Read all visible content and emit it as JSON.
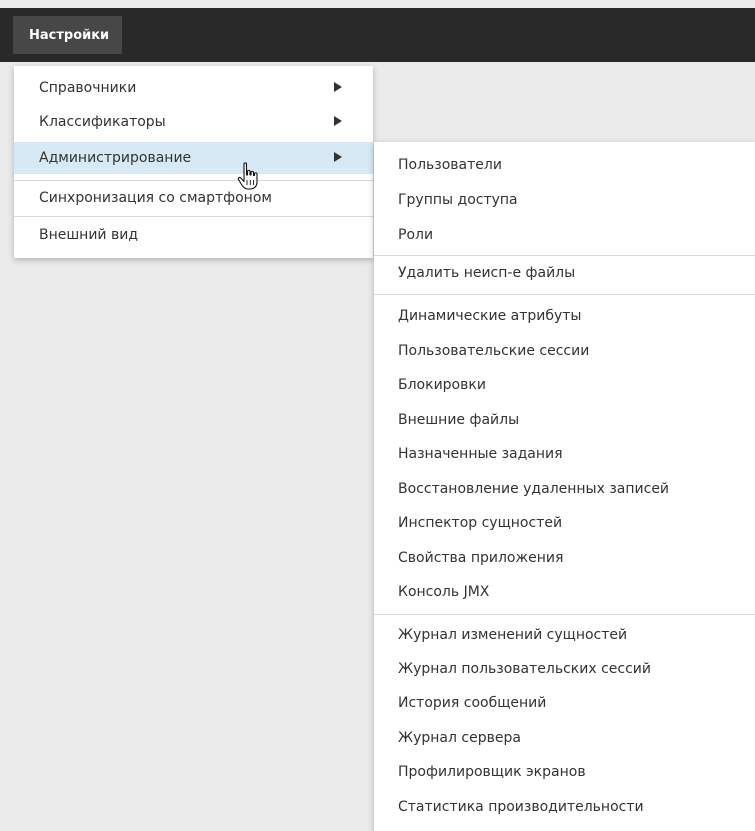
{
  "menubar": {
    "settings_label": "Настройки"
  },
  "main_menu": {
    "items": [
      {
        "label": "Справочники"
      },
      {
        "label": "Классификаторы"
      },
      {
        "label": "Администрирование"
      },
      {
        "label": "Синхронизация со смартфоном"
      },
      {
        "label": "Внешний вид"
      }
    ]
  },
  "admin_menu": {
    "items": [
      {
        "label": "Пользователи"
      },
      {
        "label": "Группы доступа"
      },
      {
        "label": "Роли"
      },
      {
        "label": "Удалить неисп-е файлы"
      },
      {
        "label": "Динамические атрибуты"
      },
      {
        "label": "Пользовательские сессии"
      },
      {
        "label": "Блокировки"
      },
      {
        "label": "Внешние файлы"
      },
      {
        "label": "Назначенные задания"
      },
      {
        "label": "Восстановление удаленных записей"
      },
      {
        "label": "Инспектор сущностей"
      },
      {
        "label": "Свойства приложения"
      },
      {
        "label": "Консоль JMX"
      },
      {
        "label": "Журнал изменений сущностей"
      },
      {
        "label": "Журнал пользовательских сессий"
      },
      {
        "label": "История сообщений"
      },
      {
        "label": "Журнал сервера"
      },
      {
        "label": "Профилировщик экранов"
      },
      {
        "label": "Статистика производительности"
      }
    ]
  },
  "colors": {
    "topbar": "#292929",
    "active_menubar": "#474747",
    "hover_item": "#d6e9f5",
    "background": "#ebebeb"
  }
}
